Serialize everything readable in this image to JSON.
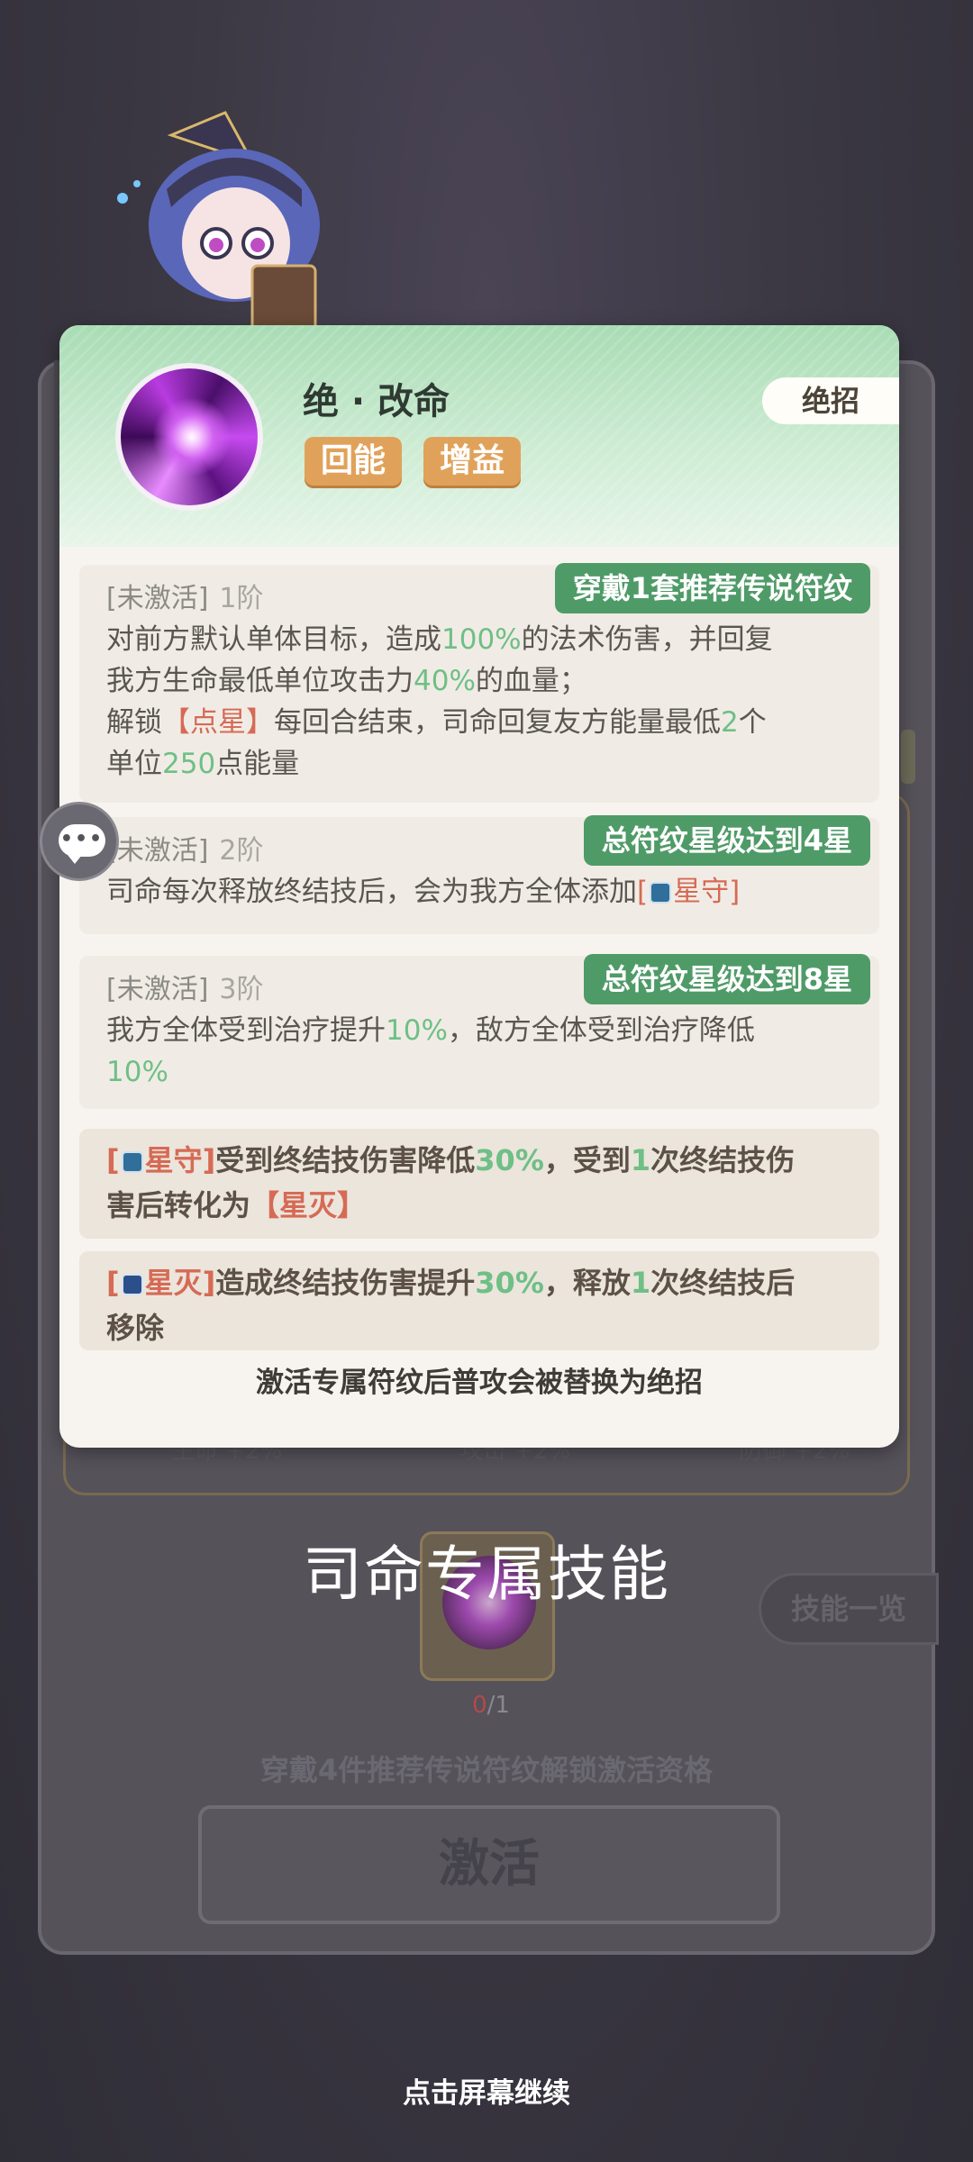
{
  "skill": {
    "name": "绝 · 改命",
    "tags": [
      "回能",
      "增益"
    ],
    "badge": "绝招"
  },
  "tiers": [
    {
      "status": "[未激活]",
      "level": "1阶",
      "requirement": "穿戴1套推荐传说符纹",
      "t1": "对前方默认单体目标，造成",
      "t1_pct": "100%",
      "t2": "的法术伤害，并回复",
      "t3": "我方生命最低单位攻击力",
      "t3_pct": "40%",
      "t4": "的血量；",
      "t5": "解锁",
      "t5_tag": "【点星】",
      "t6": "每回合结束，司命回复友方能量最低",
      "t6_num": "2",
      "t7": "个",
      "t8": "单位",
      "t8_num": "250",
      "t9": "点能量"
    },
    {
      "status": "[未激活]",
      "level": "2阶",
      "requirement": "总符纹星级达到4星",
      "t1": "司命每次释放终结技后，会为我方全体添加",
      "t1_open": "[",
      "t1_buff": "星守",
      "t1_close": "]"
    },
    {
      "status": "[未激活]",
      "level": "3阶",
      "requirement": "总符纹星级达到8星",
      "t1": "我方全体受到治疗提升",
      "t1_pct": "10%",
      "t2": "，敌方全体受到治疗降低",
      "t3_pct": "10%"
    }
  ],
  "notes": [
    {
      "open": "[",
      "buff": "星守]",
      "t1": "受到终结技伤害降低",
      "pct": "30%",
      "t2": "，受到",
      "num": "1",
      "t3": "次终结技伤",
      "t4": "害后转化为",
      "tag": "【星灭】"
    },
    {
      "open": "[",
      "buff": "星灭]",
      "t1": "造成终结技伤害提升",
      "pct": "30%",
      "t2": "，释放",
      "num": "1",
      "t3": "次终结技后",
      "t4": "移除"
    }
  ],
  "footer_note": "激活专属符纹后普攻会被替换为绝招",
  "overlay_title": "司命专属技能",
  "background": {
    "count_current": "0",
    "count_total": "/1",
    "hint": "穿戴4件推荐传说符纹解锁激活资格",
    "activate": "激活",
    "skill_list": "技能一览",
    "stats": [
      "生命 +2%",
      "攻击 +2%",
      "防御 +2%"
    ]
  },
  "continue_hint": "点击屏幕继续",
  "icons": {
    "chat": "chat-bubble-icon",
    "shield": "star-guard-icon",
    "sword": "star-destroy-icon"
  },
  "colors": {
    "green_value": "#6fbf86",
    "red_tag": "#d66a55",
    "requirement_bg": "#4f9b68",
    "tag_bg": "#e0a25a"
  }
}
